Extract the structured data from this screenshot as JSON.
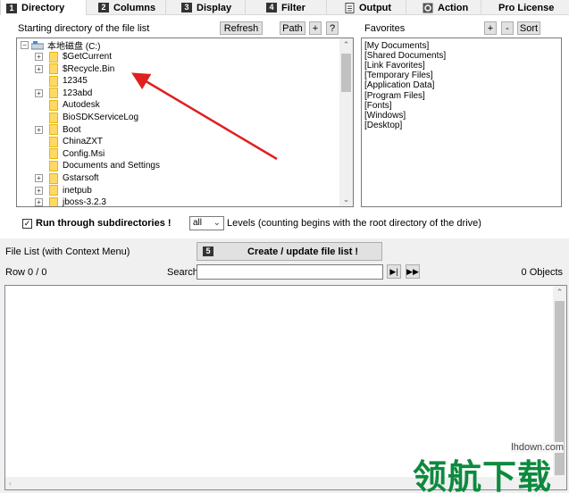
{
  "tabs": [
    {
      "num": "1",
      "label": "Directory",
      "icon": "number-badge"
    },
    {
      "num": "2",
      "label": "Columns",
      "icon": "number-badge"
    },
    {
      "num": "3",
      "label": "Display",
      "icon": "number-badge"
    },
    {
      "num": "4",
      "label": "Filter",
      "icon": "number-badge"
    },
    {
      "num": "",
      "label": "Output",
      "icon": "document-icon"
    },
    {
      "num": "",
      "label": "Action",
      "icon": "gear-icon"
    },
    {
      "num": "",
      "label": "Pro License",
      "icon": ""
    }
  ],
  "directory": {
    "start_label": "Starting directory of the file list",
    "refresh": "Refresh",
    "path": "Path",
    "plus": "+",
    "help": "?",
    "tree_root": "本地磁盘 (C:)",
    "tree_items": [
      "$GetCurrent",
      "$Recycle.Bin",
      "12345",
      "123abd",
      "Autodesk",
      "BioSDKServiceLog",
      "Boot",
      "ChinaZXT",
      "Config.Msi",
      "Documents and Settings",
      "Gstarsoft",
      "inetpub",
      "jboss-3.2.3"
    ],
    "favorites_label": "Favorites",
    "fav_plus": "+",
    "fav_minus": "-",
    "fav_sort": "Sort",
    "favorites": [
      "[My Documents]",
      "[Shared Documents]",
      "[Link Favorites]",
      "[Temporary Files]",
      "[Application Data]",
      "[Program Files]",
      "[Fonts]",
      "[Windows]",
      "[Desktop]"
    ],
    "subdir_label": "Run through subdirectories !",
    "subdir_checked": "✓",
    "levels_value": "all",
    "levels_text": "Levels  (counting begins with the root directory of the drive)"
  },
  "file_list": {
    "label": "File List (with Context Menu)",
    "create_num": "5",
    "create_label": "Create / update file list !",
    "row_status": "Row 0 / 0",
    "search_label": "Search",
    "search_value": "",
    "objects": "0 Objects"
  },
  "watermark": {
    "text": "领航下载",
    "url": "lhdown.com"
  },
  "colors": {
    "accent": "#0d8a3e",
    "arrow": "#e02020"
  }
}
